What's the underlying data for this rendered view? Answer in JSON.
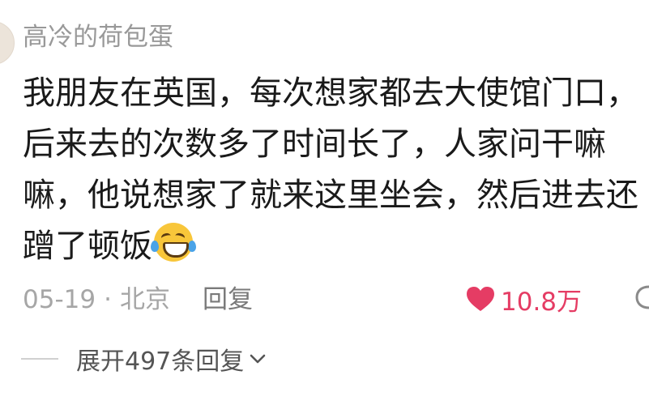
{
  "comment": {
    "username": "高冷的荷包蛋",
    "content_lines": [
      "我朋友在英国，每次想家都去大使馆门口，",
      "后来去的次数多了时间长了，人家问干嘛",
      "嘛，他说想家了就来这里坐会，然后进去还",
      "蹭了顿饭"
    ],
    "emoji": "laughing-with-tears",
    "date": "05-19",
    "separator": "·",
    "location": "北京",
    "reply_label": "回复",
    "like_count": "10.8万",
    "like_color": "#e53c64"
  },
  "replies": {
    "expand_label": "展开497条回复"
  }
}
